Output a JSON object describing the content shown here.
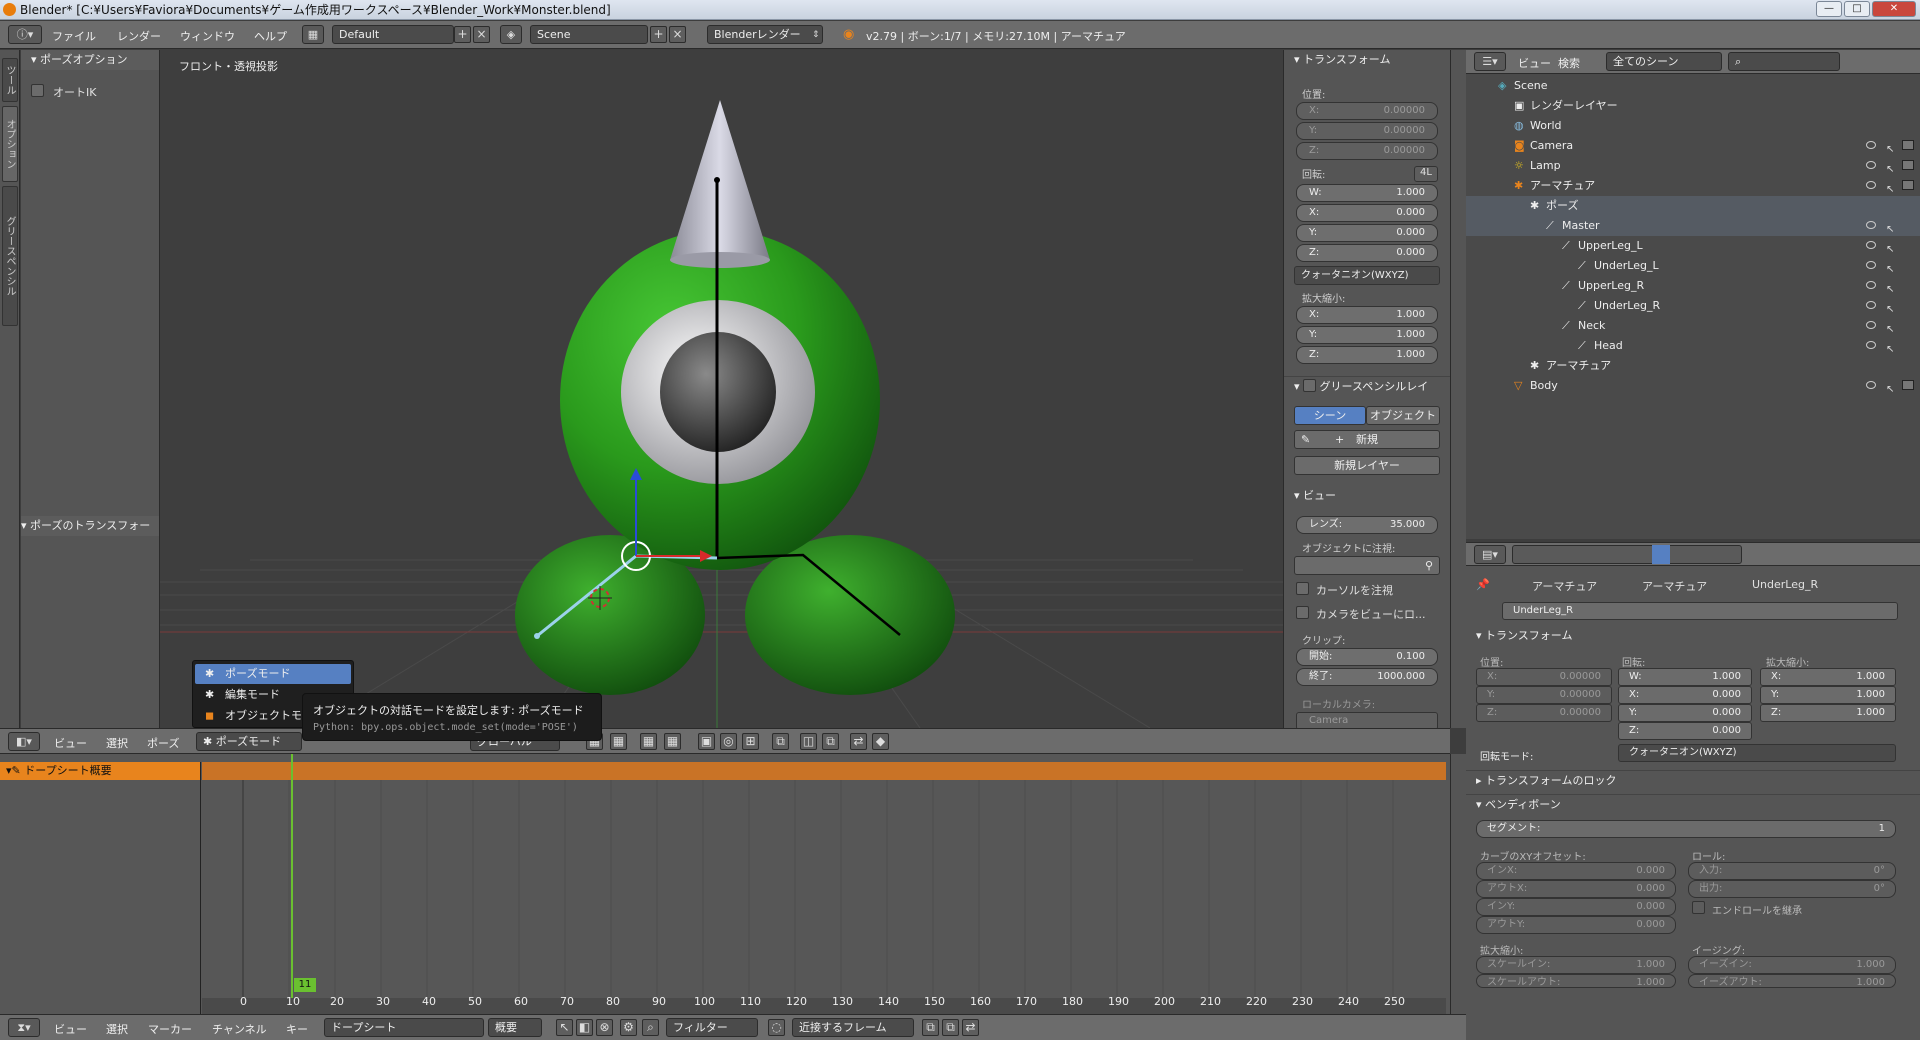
{
  "titlebar": {
    "title": "Blender* [C:¥Users¥Faviora¥Documents¥ゲーム作成用ワークスペース¥Blender_Work¥Monster.blend]",
    "btn_min": "—",
    "btn_max": "□",
    "btn_close": "✕"
  },
  "infobar": {
    "menus": [
      "ファイル",
      "レンダー",
      "ウィンドウ",
      "ヘルプ"
    ],
    "layout": "Default",
    "scene": "Scene",
    "engine": "Blenderレンダー",
    "stats": "v2.79 | ボーン:1/7 | メモリ:27.10M | アーマチュア"
  },
  "lefttabs": [
    "ツール",
    "オプション",
    "グリースペンシル"
  ],
  "toolshelf": {
    "panel1": "ポーズオプション",
    "autoik": "オートIK",
    "panel2": "ポーズのトランスフォー"
  },
  "viewport": {
    "label": "フロント・透視投影"
  },
  "npanel": {
    "transform_header": "トランスフォーム",
    "position_label": "位置:",
    "position": [
      {
        "k": "X:",
        "v": "0.00000"
      },
      {
        "k": "Y:",
        "v": "0.00000"
      },
      {
        "k": "Z:",
        "v": "0.00000"
      }
    ],
    "rotation_label": "回転:",
    "rot_4l": "4L",
    "rotation": [
      {
        "k": "W:",
        "v": "1.000"
      },
      {
        "k": "X:",
        "v": "0.000"
      },
      {
        "k": "Y:",
        "v": "0.000"
      },
      {
        "k": "Z:",
        "v": "0.000"
      }
    ],
    "rot_mode": "クォータニオン(WXYZ)",
    "scale_label": "拡大縮小:",
    "scale": [
      {
        "k": "X:",
        "v": "1.000"
      },
      {
        "k": "Y:",
        "v": "1.000"
      },
      {
        "k": "Z:",
        "v": "1.000"
      }
    ],
    "gp_header": "グリースペンシルレイ",
    "gp_scene": "シーン",
    "gp_object": "オブジェクト",
    "gp_new": "新規",
    "gp_new_layer": "新規レイヤー",
    "view_header": "ビュー",
    "lens_k": "レンズ:",
    "lens_v": "35.000",
    "focus_label": "オブジェクトに注視:",
    "lock_cursor": "カーソルを注視",
    "lock_camera": "カメラをビューにロ...",
    "clip_label": "クリップ:",
    "clip_start_k": "開始:",
    "clip_start_v": "0.100",
    "clip_end_k": "終了:",
    "clip_end_v": "1000.000",
    "local_camera_label": "ローカルカメラ:",
    "local_camera": "Camera"
  },
  "outliner_header": {
    "view": "ビュー",
    "search": "検索",
    "scenes": "全てのシーン"
  },
  "outliner": [
    {
      "indent": 0,
      "label": "Scene",
      "icon": "scene-icon"
    },
    {
      "indent": 1,
      "label": "レンダーレイヤー",
      "icon": "render-layer-icon"
    },
    {
      "indent": 1,
      "label": "World",
      "icon": "world-icon"
    },
    {
      "indent": 1,
      "label": "Camera",
      "icon": "camera-icon",
      "eye": true
    },
    {
      "indent": 1,
      "label": "Lamp",
      "icon": "lamp-icon",
      "eye": true
    },
    {
      "indent": 1,
      "label": "アーマチュア",
      "icon": "armature-icon",
      "eye": true
    },
    {
      "indent": 2,
      "label": "ポーズ",
      "icon": "pose-icon",
      "sel": true
    },
    {
      "indent": 3,
      "label": "Master",
      "icon": "bone-icon",
      "sel": true,
      "eye": true
    },
    {
      "indent": 4,
      "label": "UpperLeg_L",
      "icon": "bone-icon",
      "eye": true
    },
    {
      "indent": 5,
      "label": "UnderLeg_L",
      "icon": "bone-icon",
      "eye": true
    },
    {
      "indent": 4,
      "label": "UpperLeg_R",
      "icon": "bone-icon",
      "eye": true
    },
    {
      "indent": 5,
      "label": "UnderLeg_R",
      "icon": "bone-icon",
      "eye": true
    },
    {
      "indent": 4,
      "label": "Neck",
      "icon": "bone-icon",
      "eye": true
    },
    {
      "indent": 5,
      "label": "Head",
      "icon": "bone-icon",
      "eye": true
    },
    {
      "indent": 2,
      "label": "アーマチュア",
      "icon": "armature-data-icon"
    },
    {
      "indent": 1,
      "label": "Body",
      "icon": "mesh-icon",
      "eye": true
    }
  ],
  "props": {
    "breadcrumb": [
      "アーマチュア",
      "アーマチュア",
      "UnderLeg_R"
    ],
    "bone_name": "UnderLeg_R",
    "transform_header": "トランスフォーム",
    "pos_label": "位置:",
    "rot_label": "回転:",
    "scale_label": "拡大縮小:",
    "pos": [
      {
        "k": "X:",
        "v": "0.00000"
      },
      {
        "k": "Y:",
        "v": "0.00000"
      },
      {
        "k": "Z:",
        "v": "0.00000"
      }
    ],
    "rot": [
      {
        "k": "W:",
        "v": "1.000"
      },
      {
        "k": "X:",
        "v": "0.000"
      },
      {
        "k": "Y:",
        "v": "0.000"
      },
      {
        "k": "Z:",
        "v": "0.000"
      }
    ],
    "scale": [
      {
        "k": "X:",
        "v": "1.000"
      },
      {
        "k": "Y:",
        "v": "1.000"
      },
      {
        "k": "Z:",
        "v": "1.000"
      }
    ],
    "rot_mode_label": "回転モード:",
    "rot_mode": "クォータニオン(WXYZ)",
    "lock_header": "トランスフォームのロック",
    "bbone_header": "ベンディボーン",
    "segments_k": "セグメント:",
    "segments_v": "1",
    "curve_label": "カーブのXYオフセット:",
    "roll_label": "ロール:",
    "curve": [
      {
        "k": "インX:",
        "v": "0.000"
      },
      {
        "k": "アウトX:",
        "v": "0.000"
      },
      {
        "k": "インY:",
        "v": "0.000"
      },
      {
        "k": "アウトY:",
        "v": "0.000"
      }
    ],
    "roll": [
      {
        "k": "入力:",
        "v": "0°"
      },
      {
        "k": "出力:",
        "v": "0°"
      }
    ],
    "inherit_roll": "エンドロールを継承",
    "bscale_label": "拡大縮小:",
    "ease_label": "イージング:",
    "scale_in_k": "スケールイン:",
    "scale_in_v": "1.000",
    "scale_out_k": "スケールアウト:",
    "scale_out_v": "1.000",
    "ease_in_k": "イーズイン:",
    "ease_in_v": "1.000",
    "ease_out_k": "イーズアウト:",
    "ease_out_v": "1.000"
  },
  "vp_header": {
    "menus": [
      "ビュー",
      "選択",
      "ポーズ"
    ],
    "mode": "ポーズモード",
    "pivot": "グローバル"
  },
  "mode_popup": {
    "items": [
      "ポーズモード",
      "編集モード",
      "オブジェクトモード"
    ]
  },
  "tooltip": {
    "line1": "オブジェクトの対話モードを設定します: ポーズモード",
    "line2": "Python: bpy.ops.object.mode_set(mode='POSE')"
  },
  "dopesheet": {
    "summary": "ドープシート概要",
    "frame": "11",
    "ticks": [
      "0",
      "10",
      "20",
      "30",
      "40",
      "50",
      "60",
      "70",
      "80",
      "90",
      "100",
      "110",
      "120",
      "130",
      "140",
      "150",
      "160",
      "170",
      "180",
      "190",
      "200",
      "210",
      "220",
      "230",
      "240",
      "250"
    ]
  },
  "ds_header": {
    "menus": [
      "ビュー",
      "選択",
      "マーカー",
      "チャンネル",
      "キー"
    ],
    "mode": "ドープシート",
    "summary": "概要",
    "filter": "フィルター",
    "snap": "近接するフレーム"
  },
  "colors": {
    "accent": "#5680c2",
    "orange": "#e8841d",
    "green_body": "#2e9a1e",
    "frame_green": "#6ac030"
  }
}
